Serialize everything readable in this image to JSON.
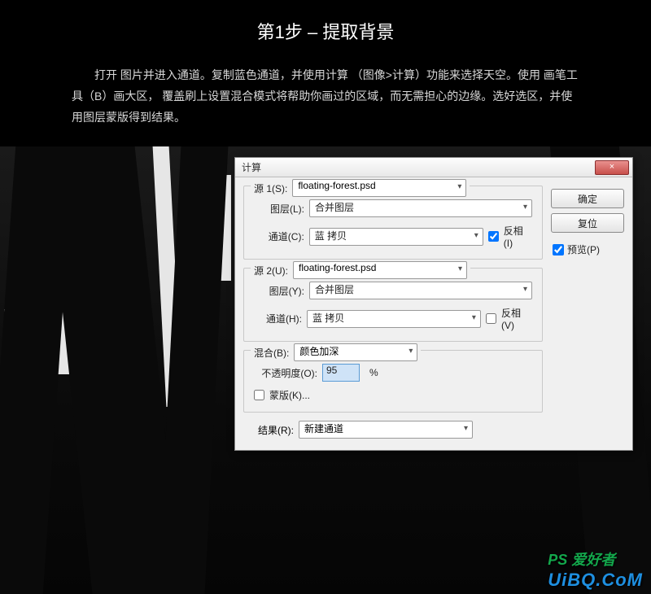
{
  "header": {
    "title": "第1步 – 提取背景",
    "desc": "　　打开  图片并进入通道。复制蓝色通道，并使用计算  （图像>计算）功能来选择天空。使用  画笔工具（B）画大区，  覆盖刷上设置混合模式将帮助你画过的区域，而无需担心的边缘。选好选区，并使用图层蒙版得到结果。"
  },
  "dialog": {
    "title": "计算",
    "close": "×",
    "ok": "确定",
    "reset": "复位",
    "preview_label": "预览(P)",
    "preview_checked": true,
    "source1": {
      "legend": "源 1(S):",
      "file": "floating-forest.psd",
      "layer_label": "图层(L):",
      "layer": "合并图层",
      "channel_label": "通道(C):",
      "channel": "蓝 拷贝",
      "invert_label": "反相(I)",
      "invert_checked": true
    },
    "source2": {
      "legend": "源 2(U):",
      "file": "floating-forest.psd",
      "layer_label": "图层(Y):",
      "layer": "合并图层",
      "channel_label": "通道(H):",
      "channel": "蓝 拷贝",
      "invert_label": "反相(V)",
      "invert_checked": false
    },
    "blend": {
      "legend": "混合(B):",
      "mode": "颜色加深",
      "opacity_label": "不透明度(O):",
      "opacity": "95",
      "pct": "%",
      "mask_label": "蒙版(K)...",
      "mask_checked": false
    },
    "result": {
      "label": "结果(R):",
      "value": "新建通道"
    }
  },
  "watermark": {
    "l1": "PS 爱好者",
    "l2": "UiBQ.CoM"
  }
}
